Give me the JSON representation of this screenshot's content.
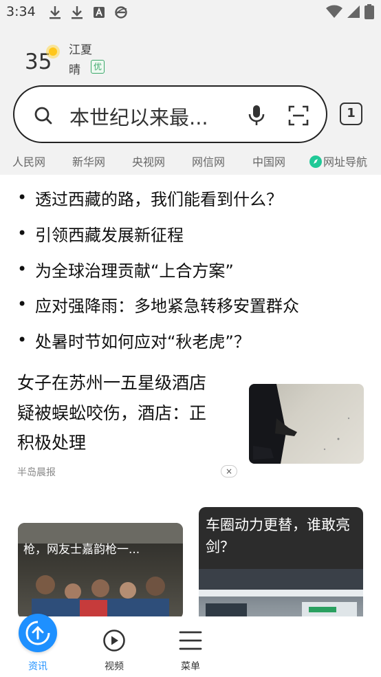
{
  "status_bar": {
    "time": "3:34",
    "icons": [
      "download-icon",
      "download-icon",
      "a-box-icon",
      "browser-e-icon",
      "wifi-icon",
      "signal-icon",
      "battery-icon"
    ]
  },
  "weather": {
    "temperature": "35",
    "city": "江夏",
    "condition": "晴",
    "air_quality": "优"
  },
  "search": {
    "query": "本世纪以来最...",
    "tab_count": "1"
  },
  "quick_links": [
    "人民网",
    "新华网",
    "央视网",
    "网信网",
    "中国网",
    "网址导航"
  ],
  "hot_list": {
    "bullet": "•",
    "items": [
      "透过西藏的路，我们能看到什么？",
      "引领西藏发展新征程",
      "为全球治理贡献“上合方案”",
      "应对强降雨：多地紧急转移安置群众",
      "处暑时节如何应对“秋老虎”？"
    ]
  },
  "news_card": {
    "title_lines": [
      "女子在苏州一五星级酒店",
      "疑被蜈蚣咬伤，酒店：正",
      "积极处理"
    ],
    "source": "半岛晨报",
    "close_symbol": "×"
  },
  "video_cards": {
    "left_title": "枪，网友士嘉韵枪一...",
    "right_title_lines": [
      "车圈动力更替，谁敢亮",
      "剑？"
    ]
  },
  "bottom_nav": {
    "items": [
      {
        "label": "资讯",
        "icon": "home-arrow-icon"
      },
      {
        "label": "视频",
        "icon": "play-circle-icon"
      },
      {
        "label": "菜单",
        "icon": "menu-icon"
      }
    ],
    "active_color": "#1e90ff"
  }
}
